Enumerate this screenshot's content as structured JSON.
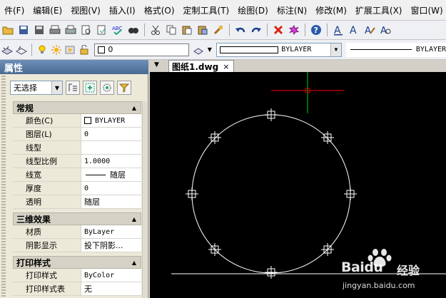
{
  "menu": [
    {
      "label": "件(F)"
    },
    {
      "label": "编辑(E)"
    },
    {
      "label": "视图(V)"
    },
    {
      "label": "插入(I)"
    },
    {
      "label": "格式(O)"
    },
    {
      "label": "定制工具(T)"
    },
    {
      "label": "绘图(D)"
    },
    {
      "label": "标注(N)"
    },
    {
      "label": "修改(M)"
    },
    {
      "label": "扩展工具(X)"
    },
    {
      "label": "窗口(W)"
    }
  ],
  "toolbar2": {
    "layer_value": "0",
    "color_value": "BYLAYER",
    "linetype_value": "BYLAYER"
  },
  "panel": {
    "title": "属性",
    "selection": "无选择",
    "sections": [
      {
        "title": "常规",
        "rows": [
          {
            "name": "颜色(C)",
            "value": "BYLAYER",
            "mono": true,
            "swatch": true
          },
          {
            "name": "图层(L)",
            "value": "0",
            "mono": true
          },
          {
            "name": "线型",
            "value": ""
          },
          {
            "name": "线型比例",
            "value": "1.0000",
            "mono": true
          },
          {
            "name": "线宽",
            "value": "随层",
            "line": true
          },
          {
            "name": "厚度",
            "value": "0",
            "mono": true
          },
          {
            "name": "透明",
            "value": "随层"
          }
        ]
      },
      {
        "title": "三维效果",
        "rows": [
          {
            "name": "材质",
            "value": "ByLayer",
            "mono": true
          },
          {
            "name": "阴影显示",
            "value": "投下阴影..."
          }
        ]
      },
      {
        "title": "打印样式",
        "rows": [
          {
            "name": "打印样式",
            "value": "ByColor",
            "mono": true
          },
          {
            "name": "打印样式表",
            "value": "无"
          }
        ]
      }
    ]
  },
  "document_tab": {
    "label": "图纸1.dwg",
    "close": "×"
  },
  "watermark": {
    "brand": "Bai",
    "brand2": "du",
    "cn": "经验",
    "url": "jingyan.baidu.com"
  },
  "colors": {
    "canvas_bg": "#000000",
    "circle": "#ffffff",
    "cursor_x": "#cc0000",
    "cursor_y": "#00aa00",
    "panel_title_bg": "#4a6a94"
  }
}
